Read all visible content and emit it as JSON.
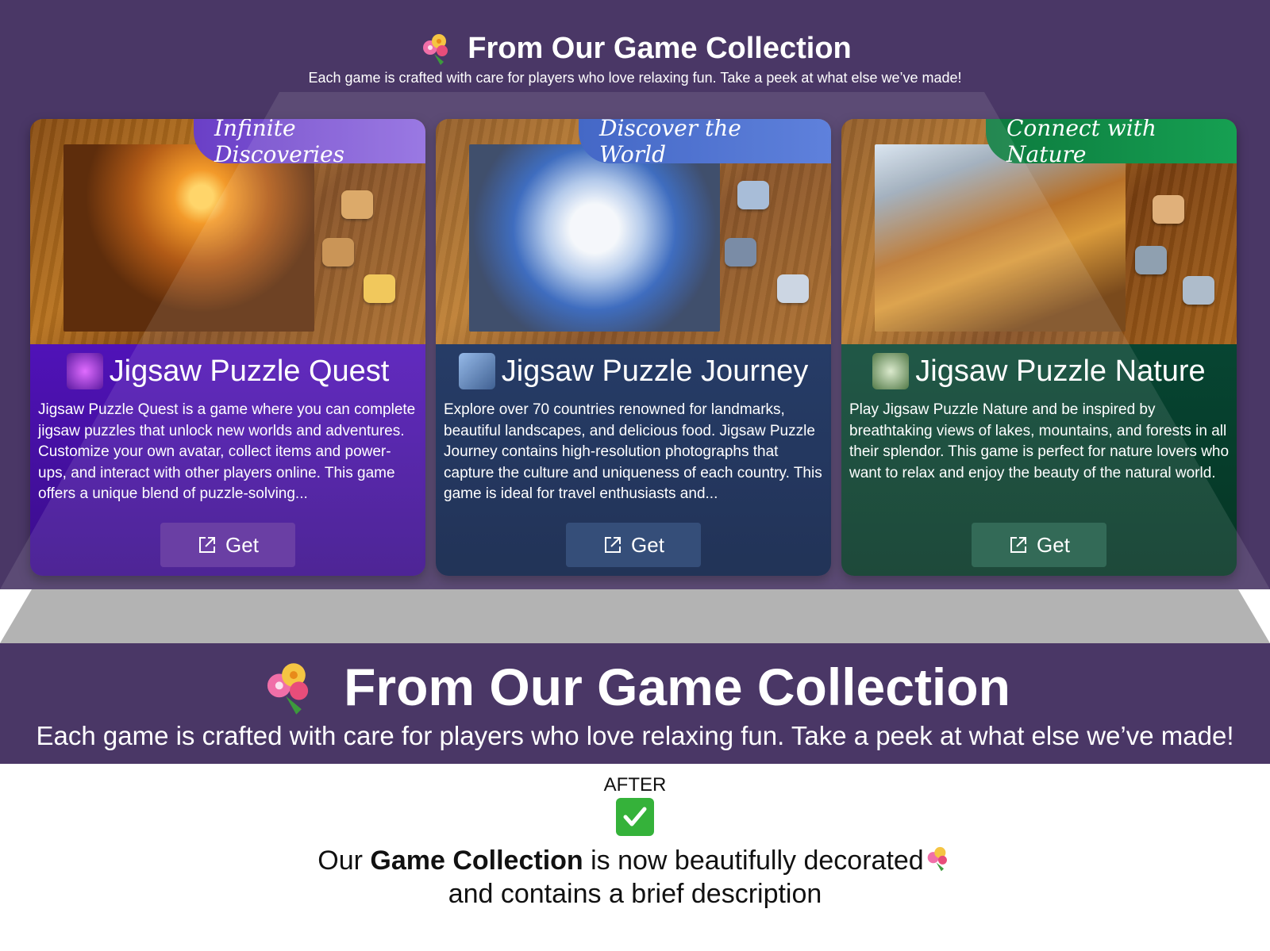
{
  "header": {
    "title": "From Our Game Collection",
    "subtitle": "Each game is crafted with care for players who love relaxing fun. Take a peek at what else we’ve made!"
  },
  "cards": [
    {
      "ribbon": "Infinite Discoveries",
      "title": "Jigsaw Puzzle Quest",
      "description": "Jigsaw Puzzle Quest is a game where you can complete jigsaw puzzles that unlock new worlds and adventures. Customize your own avatar, collect items and power-ups, and interact with other players online. This game offers a unique blend of puzzle-solving...",
      "button_label": "Get",
      "theme_color": "#4b11a8",
      "ribbon_color": "#7b4fd6"
    },
    {
      "ribbon": "Discover the World",
      "title": "Jigsaw Puzzle Journey",
      "description": "Explore over 70 countries renowned for landmarks, beautiful landscapes, and delicious food. Jigsaw Puzzle Journey contains high-resolution photographs that capture the culture and uniqueness of each country. This game is ideal for travel enthusiasts and...",
      "button_label": "Get",
      "theme_color": "#0b2352",
      "ribbon_color": "#3c5fc2"
    },
    {
      "ribbon": "Connect with Nature",
      "title": "Jigsaw Puzzle Nature",
      "description": "Play Jigsaw Puzzle Nature and be inspired by breathtaking views of lakes, mountains, and forests in all their splendor. This game is perfect for nature lovers who want to relax and enjoy the beauty of the natural world.",
      "button_label": "Get",
      "theme_color": "#063f2c",
      "ribbon_color": "#118a4a"
    }
  ],
  "zoom": {
    "title": "From Our Game Collection",
    "subtitle": "Each game is crafted with care for players who love relaxing fun. Take a peek at what else we’ve made!"
  },
  "annotation": {
    "label": "AFTER",
    "caption_prefix": "Our ",
    "caption_bold": "Game Collection",
    "caption_suffix": " is now beautifully decorated",
    "caption_line2": "and contains a brief description"
  },
  "icons": {
    "bouquet": "bouquet-icon",
    "check": "check-mark-icon",
    "external": "external-link-icon"
  }
}
